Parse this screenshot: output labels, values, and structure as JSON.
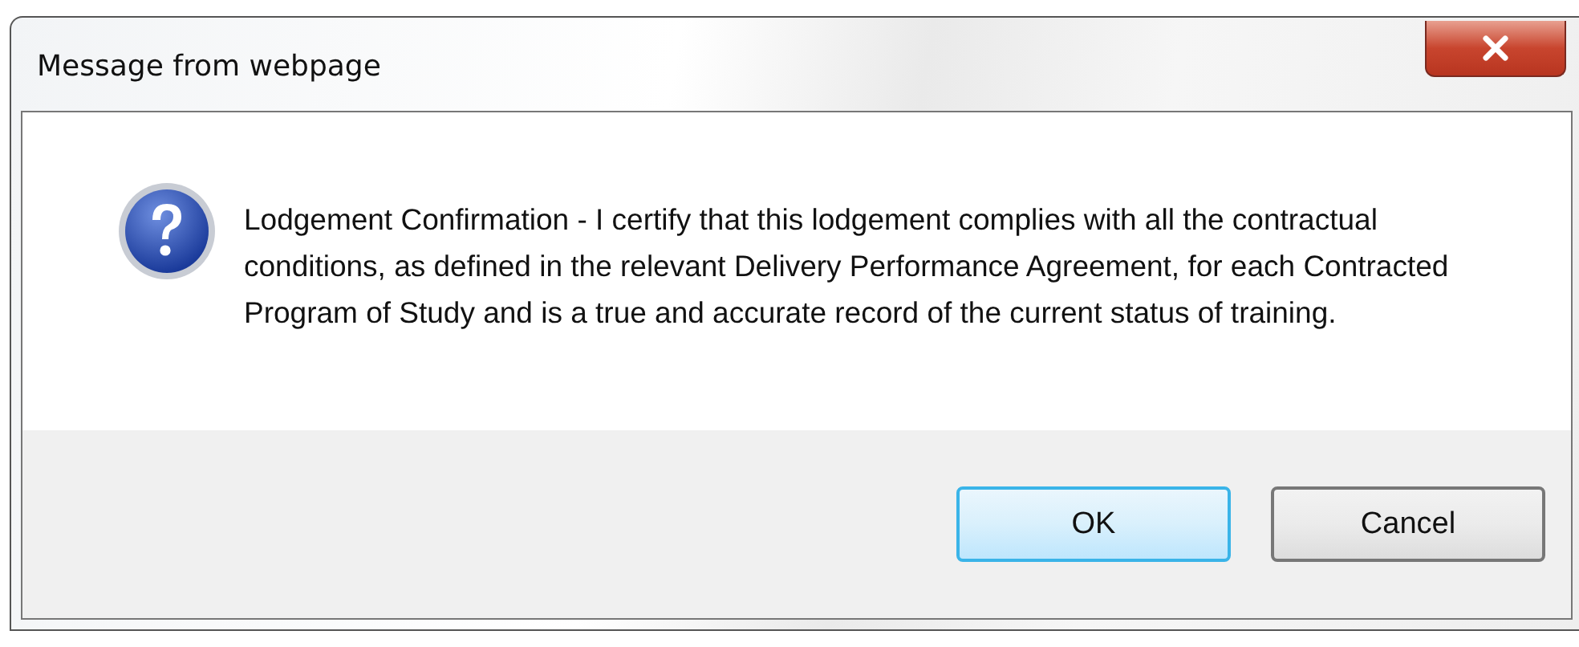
{
  "window": {
    "title": "Message from webpage"
  },
  "message": "Lodgement Confirmation - I certify that this lodgement complies with all the contractual conditions, as defined in the relevant Delivery Performance Agreement, for each Contracted Program of Study and is a true and accurate record of the current status of training.",
  "buttons": [
    {
      "label": "OK",
      "default": true
    },
    {
      "label": "Cancel",
      "default": false
    }
  ]
}
